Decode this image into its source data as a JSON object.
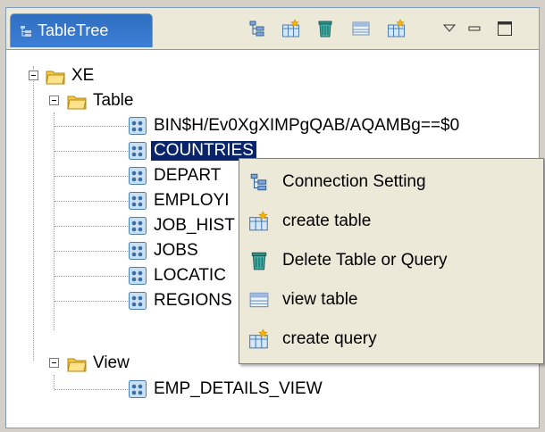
{
  "view": {
    "tab_title": "TableTree",
    "toolbar": [
      "connection-setting-icon",
      "create-table-icon",
      "delete-icon",
      "view-table-icon",
      "create-query-icon",
      "view-menu-chevron-icon",
      "minimize-icon",
      "maximize-icon"
    ]
  },
  "tree": {
    "root": "XE",
    "table_folder": "Table",
    "tables": [
      "BIN$H/Ev0XgXIMPgQAB/AQAMBg==$0",
      "COUNTRIES",
      "DEPART",
      "EMPLOYI",
      "JOB_HIST",
      "JOBS",
      "LOCATIC",
      "REGIONS"
    ],
    "view_folder": "View",
    "views": [
      "EMP_DETAILS_VIEW"
    ],
    "selected": "COUNTRIES"
  },
  "context_menu": {
    "items": [
      {
        "label": "Connection Setting",
        "icon": "connection-setting-icon"
      },
      {
        "label": "create table",
        "icon": "create-table-icon"
      },
      {
        "label": "Delete Table or Query",
        "icon": "delete-icon"
      },
      {
        "label": "view table",
        "icon": "view-table-icon"
      },
      {
        "label": "create query",
        "icon": "create-query-icon"
      }
    ]
  },
  "colors": {
    "selection": "#0a246a",
    "tab": "#3d7fd6",
    "folder": "#f2c94c"
  }
}
